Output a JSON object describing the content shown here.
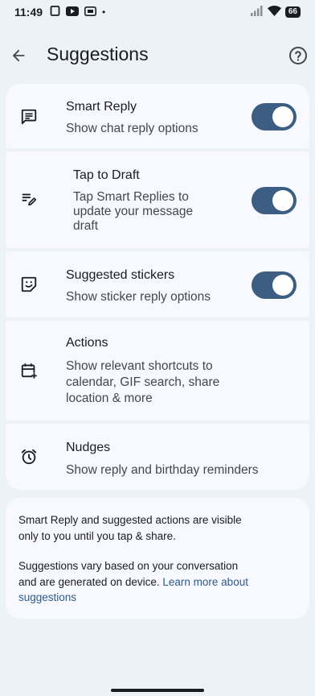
{
  "status_bar": {
    "time": "11:49",
    "battery": "66",
    "dot": "•"
  },
  "app_bar": {
    "title": "Suggestions"
  },
  "rows": [
    {
      "title": "Smart Reply",
      "subtitle": "Show chat reply options",
      "toggle": true,
      "toggle_on": true,
      "icon": "chat-icon"
    },
    {
      "title": "Tap to Draft",
      "subtitle_lines": [
        "Tap Smart Replies to",
        "update your message",
        "draft"
      ],
      "toggle": true,
      "toggle_on": true,
      "icon": "edit-notes-icon"
    },
    {
      "title": "Suggested stickers",
      "subtitle": "Show sticker reply options",
      "toggle": true,
      "toggle_on": true,
      "icon": "sticker-icon"
    },
    {
      "title": "Actions",
      "subtitle_lines": [
        "Show relevant shortcuts to",
        "calendar, GIF search, share",
        "location & more"
      ],
      "toggle": false,
      "icon": "calendar-add-icon"
    },
    {
      "title": "Nudges",
      "subtitle": "Show reply and birthday reminders",
      "toggle": false,
      "icon": "alarm-icon"
    }
  ],
  "footer": {
    "p1_lines": [
      "Smart Reply and suggested actions are visible",
      "only to you until you tap & share."
    ],
    "p2_line1": "Suggestions vary based on your conversation",
    "p2_line2_prefix": "and are generated on device. ",
    "p2_link_part1": "Learn more about",
    "p2_link_part2": "suggestions"
  },
  "colors": {
    "background": "#edf1f8",
    "card": "#f8f9ff",
    "toggle_track": "#3b5e82",
    "link": "#2e5a8c"
  }
}
